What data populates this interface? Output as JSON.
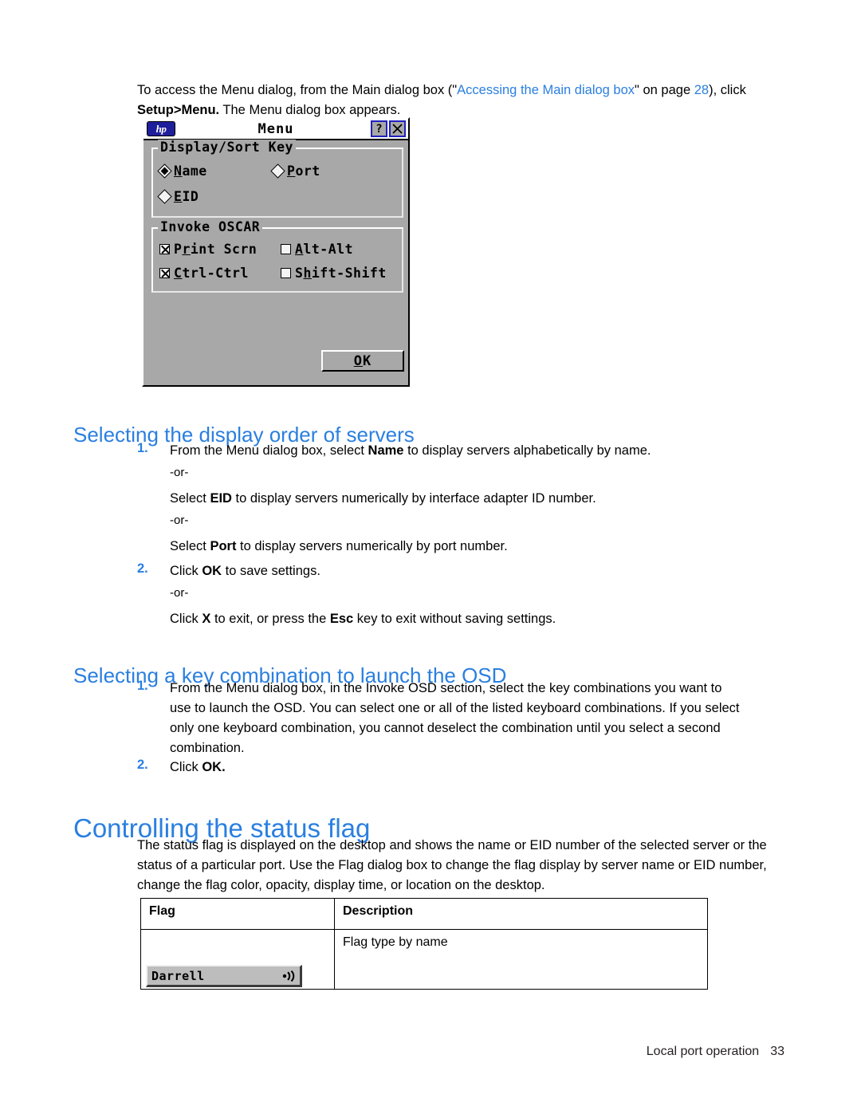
{
  "intro": {
    "before_link": "To access the Menu dialog, from the Main dialog box (\"",
    "link_text": "Accessing the Main dialog box",
    "after_link": "\" on page ",
    "page_ref": "28",
    "tail": "), click ",
    "bold_cmd": "Setup>Menu.",
    "tail2": " The Menu dialog box appears."
  },
  "dialog": {
    "logo_text": "hp",
    "title": "Menu",
    "help_button": "?",
    "close_button": "X",
    "display_sort": {
      "legend": "Display/Sort Key",
      "options": [
        {
          "label": "Name",
          "mnemonic": "N",
          "selected": true
        },
        {
          "label": "Port",
          "mnemonic": "P",
          "selected": false
        },
        {
          "label": "EID",
          "mnemonic": "E",
          "selected": false
        }
      ]
    },
    "invoke_oscar": {
      "legend": "Invoke OSCAR",
      "options": [
        {
          "label": "Print Scrn",
          "mnemonic": "r",
          "checked": true
        },
        {
          "label": "Alt-Alt",
          "mnemonic": "A",
          "checked": false
        },
        {
          "label": "Ctrl-Ctrl",
          "mnemonic": "C",
          "checked": true
        },
        {
          "label": "Shift-Shift",
          "mnemonic": "h",
          "checked": false
        }
      ]
    },
    "ok_label": "OK"
  },
  "section1": {
    "heading": "Selecting the display order of servers",
    "item1_num": "1.",
    "item1_a": "From the Menu dialog box, select ",
    "item1_a_bold": "Name",
    "item1_a_tail": " to display servers alphabetically by name.",
    "or1": "-or-",
    "item1_b": "Select ",
    "item1_b_bold": "EID",
    "item1_b_tail": " to display servers numerically by interface adapter ID number.",
    "or2": "-or-",
    "item1_c": "Select ",
    "item1_c_bold": "Port",
    "item1_c_tail": " to display servers numerically by port number.",
    "item2_num": "2.",
    "item2_a": "Click ",
    "item2_a_bold": "OK",
    "item2_a_tail": " to save settings.",
    "or3": "-or-",
    "item2_b": "Click ",
    "item2_b_bold": "X",
    "item2_b_mid": " to exit, or press the ",
    "item2_b_bold2": "Esc",
    "item2_b_tail": " key to exit without saving settings."
  },
  "section2": {
    "heading": "Selecting a key combination to launch the OSD",
    "item1_num": "1.",
    "item1_text": "From the Menu dialog box, in the Invoke OSD section, select the key combinations you want to use to launch the OSD. You can select one or all of the listed keyboard combinations. If you select only one keyboard combination, you cannot deselect the combination until you select a second combination.",
    "item2_num": "2.",
    "item2_a": "Click ",
    "item2_a_bold": "OK."
  },
  "section3": {
    "heading": "Controlling the status flag",
    "para": "The status flag is displayed on the desktop and shows the name or EID number of the selected server or the status of a particular port. Use the Flag dialog box to change the flag display by server name or EID number, change the flag color, opacity, display time, or location on the desktop.",
    "table": {
      "headers": [
        "Flag",
        "Description"
      ],
      "rows": [
        {
          "flag_label": "Darrell",
          "description": "Flag type by name"
        }
      ]
    }
  },
  "footer": {
    "title": "Local port operation",
    "page": "33"
  },
  "colors": {
    "link": "#2a7fe0",
    "heading": "#2a7fe0",
    "dialog_bg": "#a8a8a8",
    "hp_blue": "#1f1f9c"
  }
}
